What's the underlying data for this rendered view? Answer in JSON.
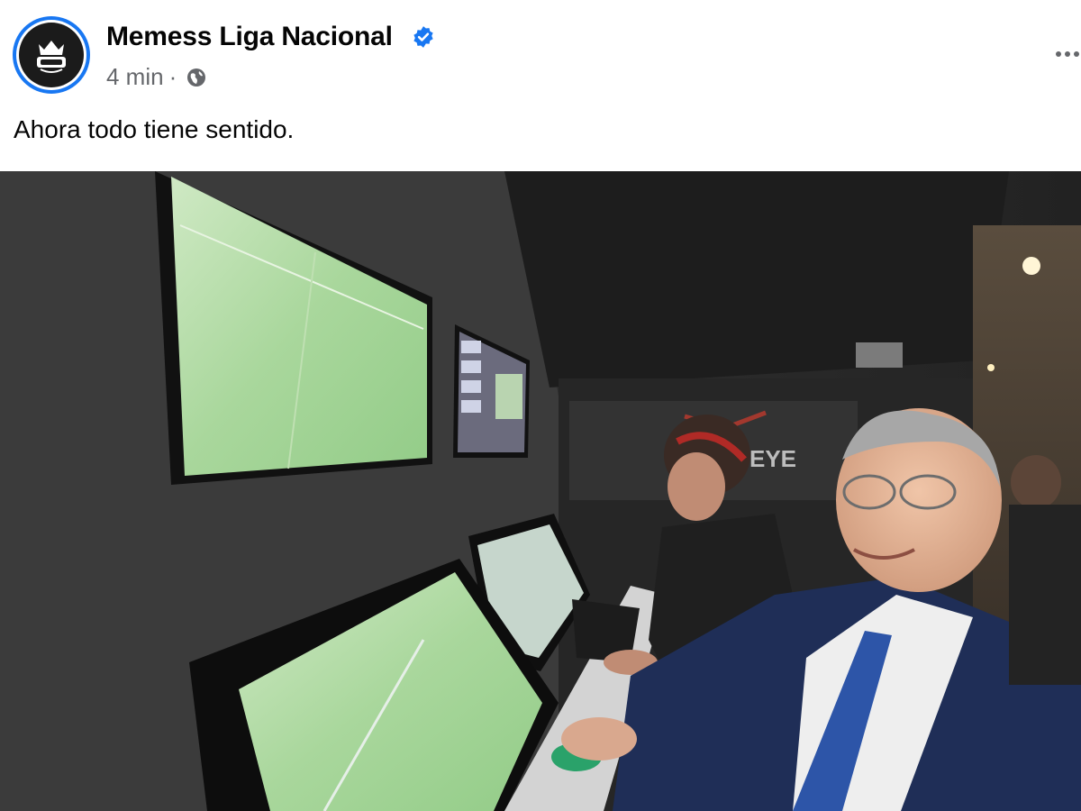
{
  "post": {
    "page_name": "Memess Liga Nacional",
    "verified": true,
    "time": "4 min",
    "separator": "·",
    "audience_icon": "globe-icon",
    "more_icon": "more-options-icon",
    "text": "Ahora todo tiene sentido."
  },
  "photo": {
    "wall_brand_text": "EYE"
  },
  "colors": {
    "verified_blue": "#1877f2",
    "meta_gray": "#65676b",
    "text": "#050505"
  }
}
